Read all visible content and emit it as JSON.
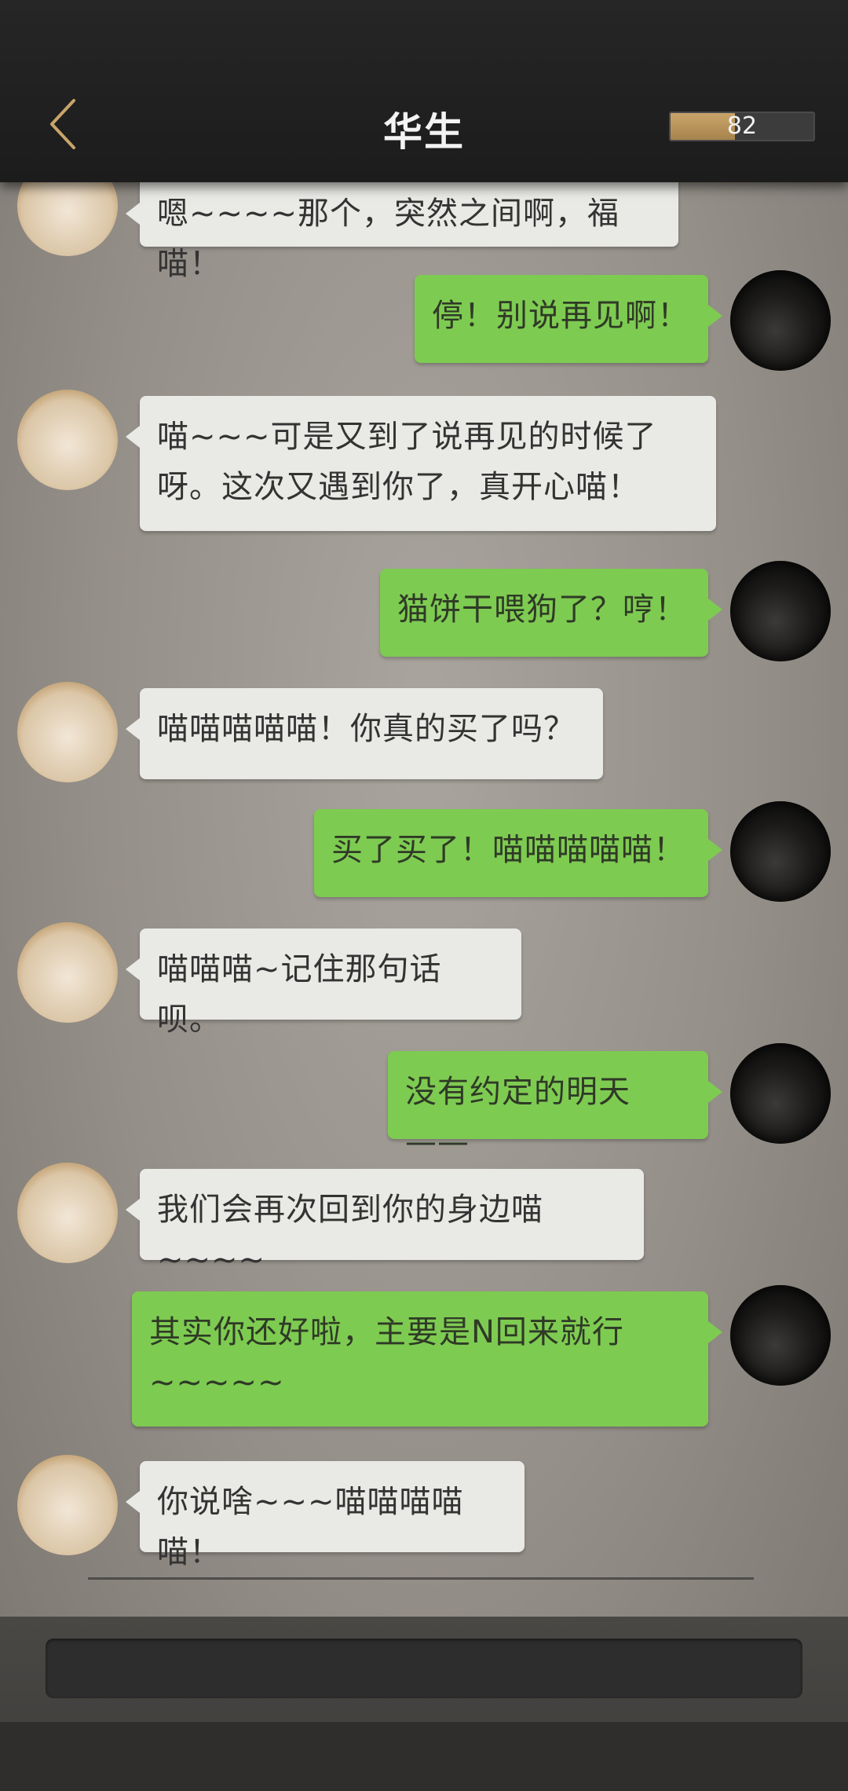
{
  "header": {
    "title": "华生",
    "progress_value": "82",
    "progress_fraction": 0.45
  },
  "messages": [
    {
      "side": "left",
      "text": "嗯~~~~那个，突然之间啊，福喵！"
    },
    {
      "side": "right",
      "text": "停！别说再见啊！"
    },
    {
      "side": "left",
      "text": "喵~~~可是又到了说再见的时候了呀。这次又遇到你了，真开心喵！"
    },
    {
      "side": "right",
      "text": "猫饼干喂狗了？哼！"
    },
    {
      "side": "left",
      "text": "喵喵喵喵喵！你真的买了吗？"
    },
    {
      "side": "right",
      "text": "买了买了！喵喵喵喵喵！"
    },
    {
      "side": "left",
      "text": "喵喵喵~记住那句话呗。"
    },
    {
      "side": "right",
      "text": "没有约定的明天——"
    },
    {
      "side": "left",
      "text": "我们会再次回到你的身边喵~~~~"
    },
    {
      "side": "right",
      "text": "其实你还好啦，主要是N回来就行~~~~~"
    },
    {
      "side": "left",
      "text": "你说啥~~~喵喵喵喵喵！"
    }
  ],
  "icons": {
    "back": "chevron-left-icon",
    "cat_avatar": "cat-avatar",
    "user_avatar": "user-avatar"
  },
  "colors": {
    "header_bg": "#222222",
    "left_bubble": "#e9e9e6",
    "right_bubble": "#7ecb52",
    "progress_fill": "#b8935a",
    "back_icon": "#c9a46a"
  }
}
